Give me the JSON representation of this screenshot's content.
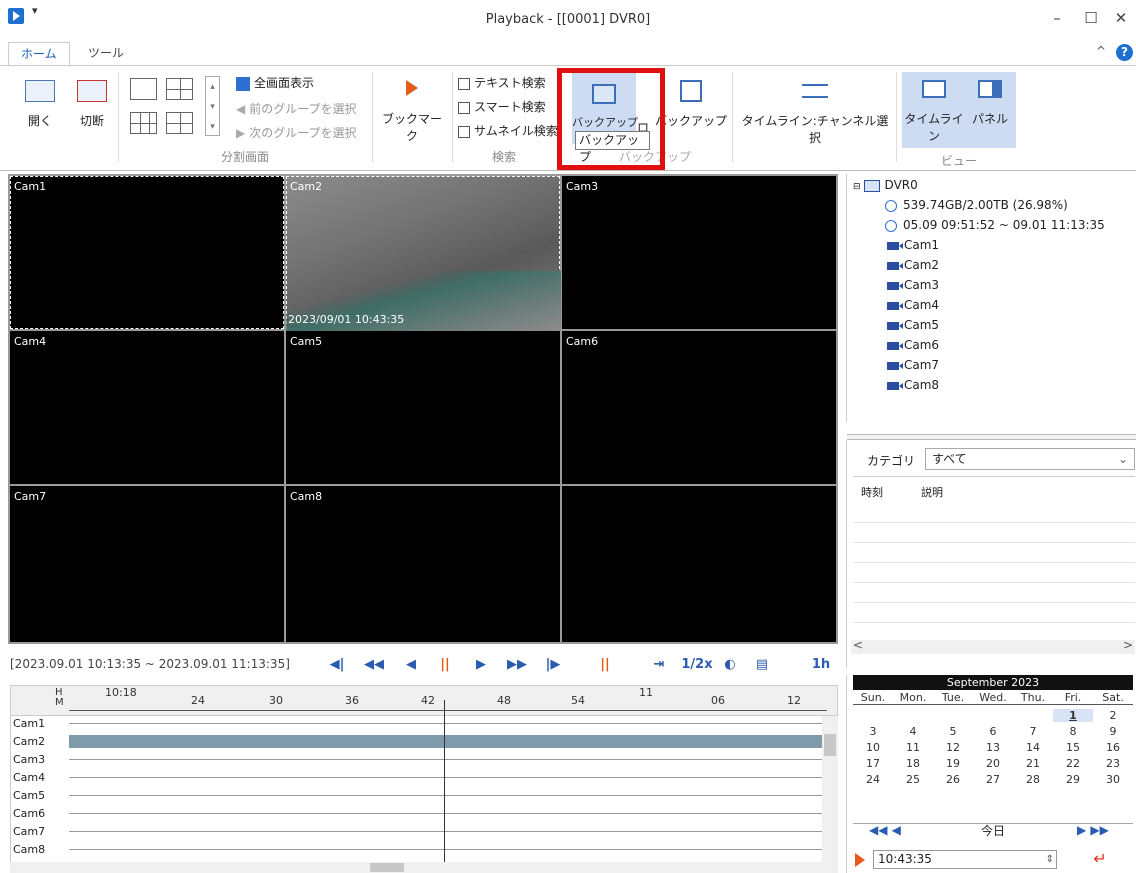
{
  "window": {
    "title": "Playback - [[0001] DVR0]",
    "qa_drop": "▾"
  },
  "tabs": [
    {
      "label": "ホーム"
    },
    {
      "label": "ツール"
    }
  ],
  "ribbon": {
    "open_label": "開く",
    "disconnect_label": "切断",
    "split_group": "分割画面",
    "fullscreen": "全画面表示",
    "prev_group": "前のグループを選択",
    "next_group": "次のグループを選択",
    "bookmark": "ブックマーク",
    "text_search": "テキスト検索",
    "smart_search": "スマート検索",
    "thumb_search": "サムネイル検索",
    "search_group": "検索",
    "backup": "バックアップ",
    "backup2_prefix": "ロ",
    "backup2": "バックアップ",
    "backup_group_visible": "バックアップ",
    "tooltip": "バックアップ",
    "timeline_ch": "タイムライン:チャンネル選択",
    "timeline": "タイムライン",
    "panel": "パネル",
    "view_group": "ビュー"
  },
  "cams": [
    {
      "label": "Cam1"
    },
    {
      "label": "Cam2",
      "timestamp": "2023/09/01 10:43:35"
    },
    {
      "label": "Cam3"
    },
    {
      "label": "Cam4"
    },
    {
      "label": "Cam5"
    },
    {
      "label": "Cam6"
    },
    {
      "label": "Cam7"
    },
    {
      "label": "Cam8"
    },
    {
      "label": ""
    }
  ],
  "playback": {
    "range": "[2023.09.01 10:13:35 ~ 2023.09.01 11:13:35]",
    "speed": "1/2x",
    "zoom": "1h",
    "buttons": [
      "◀|",
      "◀◀",
      "◀",
      "||",
      "▶",
      "▶▶",
      "|▶"
    ]
  },
  "timeline": {
    "hm_h": "H",
    "hm_m": "M",
    "hour_labels": [
      "10:18",
      "11"
    ],
    "minute_labels": [
      "24",
      "30",
      "36",
      "42",
      "48",
      "54",
      "06",
      "12"
    ],
    "rows": [
      "Cam1",
      "Cam2",
      "Cam3",
      "Cam4",
      "Cam5",
      "Cam6",
      "Cam7",
      "Cam8"
    ]
  },
  "tree": {
    "root": "DVR0",
    "storage": "539.74GB/2.00TB (26.98%)",
    "range": "05.09 09:51:52 ~ 09.01 11:13:35",
    "cams": [
      "Cam1",
      "Cam2",
      "Cam3",
      "Cam4",
      "Cam5",
      "Cam6",
      "Cam7",
      "Cam8"
    ]
  },
  "events": {
    "category_label": "カテゴリ",
    "category_value": "すべて",
    "col_time": "時刻",
    "col_desc": "説明"
  },
  "calendar": {
    "month": "September 2023",
    "weekdays": [
      "Sun.",
      "Mon.",
      "Tue.",
      "Wed.",
      "Thu.",
      "Fri.",
      "Sat."
    ],
    "weeks": [
      [
        "",
        "",
        "",
        "",
        "",
        "1",
        "2"
      ],
      [
        "3",
        "4",
        "5",
        "6",
        "7",
        "8",
        "9"
      ],
      [
        "10",
        "11",
        "12",
        "13",
        "14",
        "15",
        "16"
      ],
      [
        "17",
        "18",
        "19",
        "20",
        "21",
        "22",
        "23"
      ],
      [
        "24",
        "25",
        "26",
        "27",
        "28",
        "29",
        "30"
      ]
    ],
    "today": "今日",
    "time_value": "10:43:35"
  }
}
